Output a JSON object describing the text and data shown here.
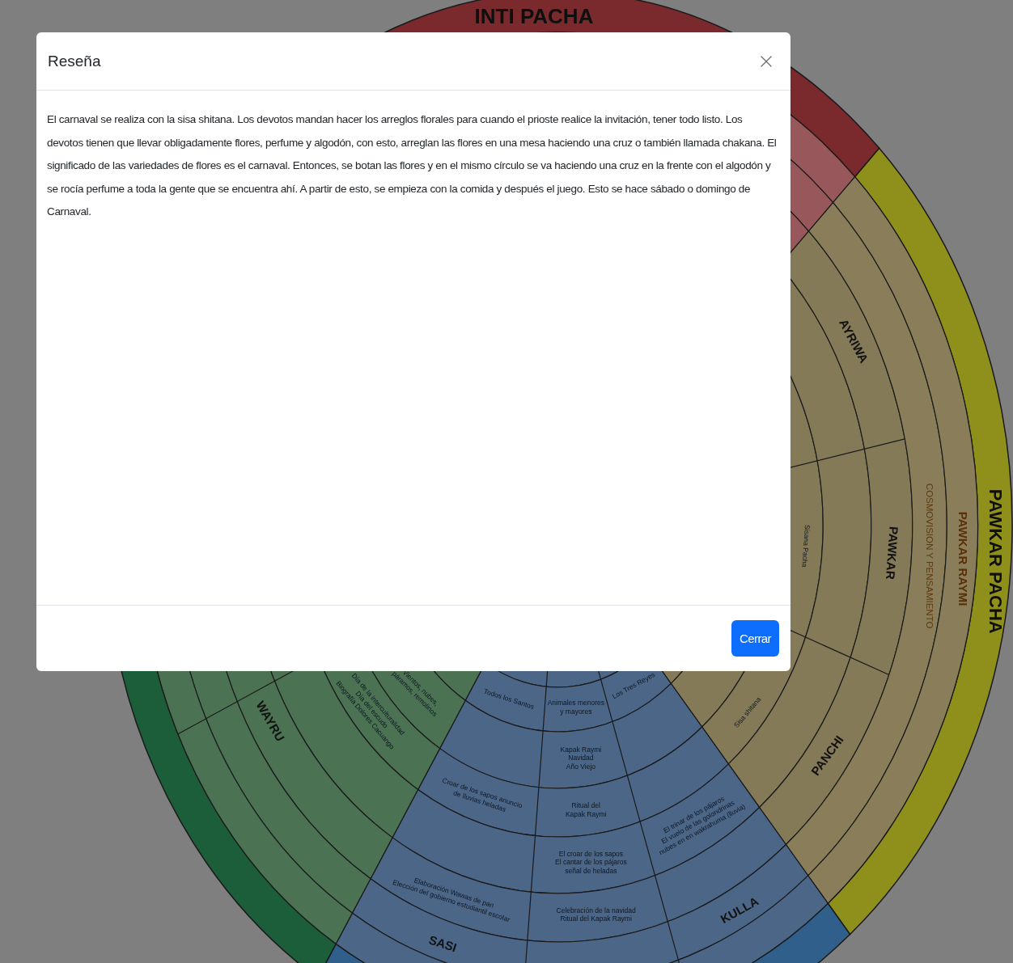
{
  "wheel": {
    "seasons": [
      "INTI PACHA",
      "PAWKAR PACHA"
    ],
    "ring_labels": [
      "PAWKAR RAYMI",
      "COSMOVISION Y PENSAMIENTO"
    ],
    "months": [
      "AYRIWA",
      "PAWKAR",
      "PANCHI",
      "KULLA",
      "SASI",
      "WAYRU"
    ],
    "notes": [
      {
        "lines": [
          "Animales menores",
          "y mayores"
        ]
      },
      {
        "lines": [
          "Kapak Raymi",
          "Navidad",
          "Año Viejo"
        ]
      },
      {
        "lines": [
          "Ritual del",
          "Kapak Raymi"
        ]
      },
      {
        "lines": [
          "El croar de los sapos",
          "El cantar de los pájaros",
          "señal de heladas"
        ]
      },
      {
        "lines": [
          "Celebración de la navidad",
          "Ritual del Kapak Raymi"
        ]
      },
      {
        "lines": [
          "Todos los Santos"
        ]
      },
      {
        "lines": [
          "Croar de los sapos anuncio",
          "de lluvias heladas"
        ]
      },
      {
        "lines": [
          "Elaboración Wawas de pan",
          "Elección del gobierno estudiantil escolar"
        ]
      },
      {
        "lines": [
          "Los Tres Reyes"
        ]
      },
      {
        "lines": [
          "El trinar de los pájaros",
          "El vuelo de las golondrinas",
          "nubes en en wakrahuma (lluvia)"
        ]
      },
      {
        "lines": [
          "Sisana Pacha"
        ]
      },
      {
        "lines": [
          "Sisa shitana"
        ]
      },
      {
        "lines": [
          "Día de la interculturalidad",
          "Día del escudo",
          "Biografía Dolores Cacuango"
        ]
      },
      {
        "lines": [
          "Vientos, nubes,",
          "páramos, remolinos"
        ]
      }
    ]
  },
  "modal": {
    "title": "Reseña",
    "body": "El carnaval se realiza con la sisa shitana. Los devotos mandan hacer los arreglos florales para cuando el prioste realice la invitación, tener todo listo. Los devotos tienen que llevar obligadamente flores, perfume y algodón, con esto, arreglan las flores en una mesa haciendo una cruz o también llamada chakana. El significado de las variedades de flores es el carnaval. Entonces, se botan las flores y en el mismo círculo se va haciendo una cruz en la frente con el algodón y se rocía perfume a toda la gente que se encuentra ahí. A partir de esto, se empieza con la comida y después el juego. Esto se hace sábado o domingo de Carnaval.",
    "close_button": "Cerrar"
  }
}
